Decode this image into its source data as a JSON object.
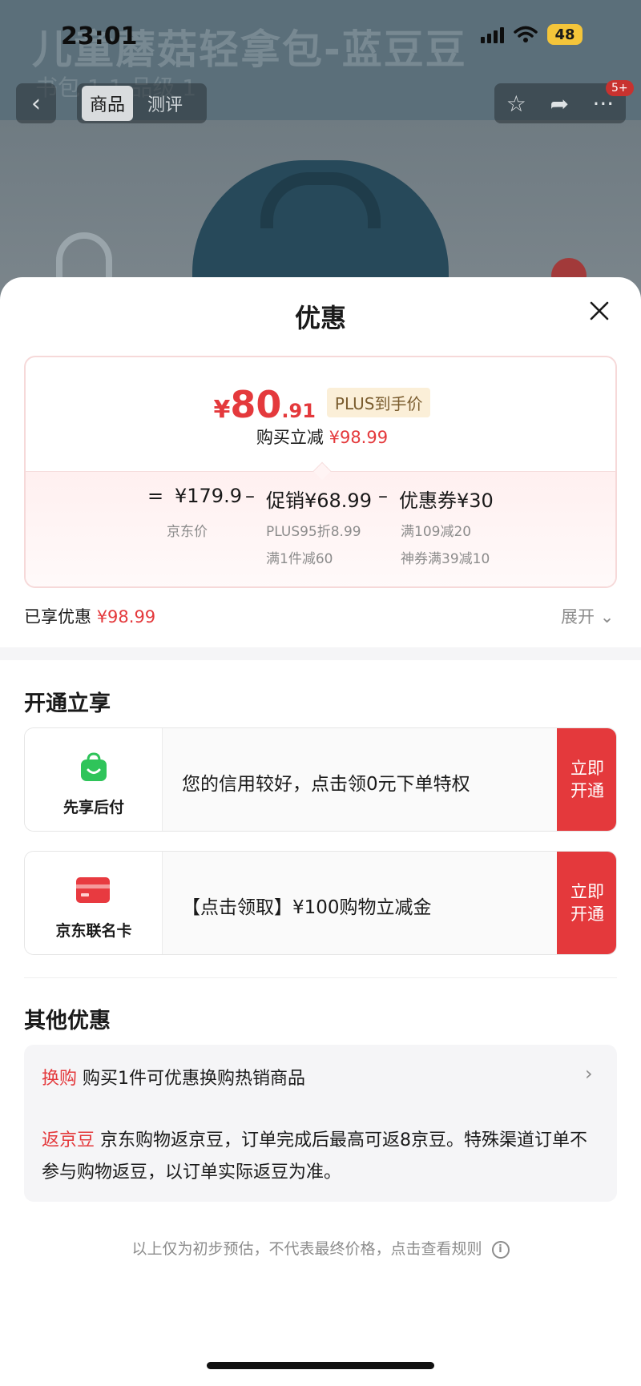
{
  "status_bar": {
    "time": "23:01",
    "battery": "48"
  },
  "background": {
    "title": "儿童蘑菇轻拿包-蓝豆豆",
    "subtitle": "书包 1 1 品级 1"
  },
  "nav": {
    "back_icon": "chevron-left-icon",
    "tabs": [
      {
        "label": "商品",
        "active": true
      },
      {
        "label": "测评",
        "active": false
      }
    ],
    "badge": "5+"
  },
  "sheet": {
    "title": "优惠",
    "close_icon": "close-icon"
  },
  "price_card": {
    "currency": "¥",
    "price_int": "80",
    "price_dec": ".91",
    "plus_tag": "PLUS到手价",
    "reduce_label": "购买立减",
    "reduce_value": "¥98.99",
    "equals": "=",
    "minus": "–",
    "base_price": "¥179.9",
    "base_label": "京东价",
    "promo": "促销¥68.99",
    "promo_details": [
      "PLUS95折8.99",
      "满1件减60"
    ],
    "coupon": "优惠券¥30",
    "coupon_details": [
      "满109减20",
      "神券满39减10"
    ]
  },
  "summary": {
    "enjoyed_label": "已享优惠",
    "enjoyed_value": "¥98.99",
    "expand_label": "展开"
  },
  "open_section": {
    "title": "开通立享",
    "items": [
      {
        "icon": "shopping-bag-icon",
        "name": "先享后付",
        "text": "您的信用较好，点击领0元下单特权",
        "button_line1": "立即",
        "button_line2": "开通"
      },
      {
        "icon": "credit-card-icon",
        "name": "京东联名卡",
        "text": "【点击领取】¥100购物立减金",
        "button_line1": "立即",
        "button_line2": "开通"
      }
    ]
  },
  "other_section": {
    "title": "其他优惠",
    "items": [
      {
        "tag": "换购",
        "text": "购买1件可优惠换购热销商品"
      },
      {
        "tag": "返京豆",
        "text": "京东购物返京豆，订单完成后最高可返8京豆。特殊渠道订单不参与购物返豆，以订单实际返豆为准。"
      }
    ]
  },
  "footnote": "以上仅为初步预估，不代表最终价格，点击查看规则",
  "colors": {
    "accent": "#e4393c",
    "plus_tag_bg": "#fbefd8",
    "green": "#2fc45a"
  }
}
